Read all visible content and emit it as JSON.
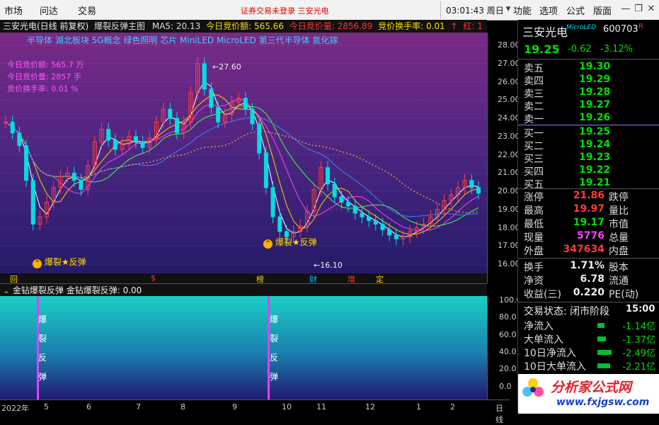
{
  "topbar": {
    "menu_left": [
      "市场",
      "问达",
      "交易"
    ],
    "notice": "证券交易未登录  三安光电",
    "clock": "03:01:43 周日",
    "menu_right": [
      "功能",
      "选项",
      "公式",
      "版面"
    ]
  },
  "main_chart": {
    "title_stock": "三安光电(日线 前复权)",
    "title_indicator": "爆裂反弹主图",
    "ma5": "MA5: 20.13",
    "auction_amount": "今日竞价额: 565.66",
    "auction_volume": "今日竞价量: 2856.89",
    "auction_turnover": "竞价换手率: 0.01",
    "red_count": "红: 1",
    "concepts": "半导体 湖北板块 5G概念 绿色照明 芯片 MiniLED MicroLED 第三代半导体 氮化镓",
    "overlay_lines": [
      "今日竞价额: 565.7 万",
      "今日竞价量: 2857 手",
      "竞价换手率: 0.01 %"
    ],
    "high_label": "27.60",
    "low_label": "16.10",
    "signal_label_1": "爆裂★反弹",
    "signal_label_2": "爆裂★反弹",
    "event_markers": [
      "回",
      "$",
      "榜",
      "财",
      "增",
      "定"
    ],
    "chart_data": {
      "type": "line",
      "title": "",
      "ylim": [
        15.5,
        28.7
      ],
      "y_ticks": [
        16.0,
        17.0,
        18.0,
        19.0,
        20.0,
        21.0,
        22.0,
        23.0,
        24.0,
        25.0,
        26.0,
        27.0,
        28.0
      ],
      "x_ticks": [
        "2022年",
        "5",
        "6",
        "7",
        "8",
        "9",
        "10",
        "11",
        "12",
        "1",
        "2",
        "日线"
      ],
      "series": [
        {
          "values": [
            23.8,
            23.2,
            22.5,
            20.6,
            18.2,
            18.6,
            19.4,
            20.2,
            20.8,
            21.0,
            20.6,
            20.1,
            21.4,
            22.7,
            23.4,
            22.8,
            22.3,
            22.6,
            23.0,
            22.7,
            22.4,
            22.9,
            23.8,
            24.5,
            24.0,
            23.2,
            23.8,
            25.4,
            27.0,
            25.6,
            24.6,
            23.8,
            24.2,
            24.9,
            25.1,
            24.5,
            23.7,
            22.1,
            20.2,
            18.6,
            17.8,
            17.5,
            17.8,
            18.1,
            18.9,
            20.1,
            21.3,
            20.4,
            19.7,
            19.4,
            19.2,
            18.8,
            18.6,
            18.4,
            18.2,
            17.9,
            17.6,
            17.4,
            17.5,
            17.8,
            18.0,
            18.2,
            18.6,
            19.0,
            19.5,
            19.8,
            20.2,
            20.6,
            20.2,
            19.9
          ]
        }
      ]
    }
  },
  "sub_chart": {
    "title": "金钻爆裂反弹 金钻爆裂反弹: 0.00",
    "vertical_text_chars": [
      "爆",
      "裂",
      "反",
      "弹"
    ],
    "y_ticks": [
      "100.0",
      "80.0",
      "60.0",
      "40.0",
      "20.0",
      "0.0"
    ]
  },
  "panel": {
    "stock_name": "三安光电",
    "concept_tag": "MicroLED",
    "code": "600703",
    "flag": "R",
    "price": "19.25",
    "change": "-0.62",
    "change_pct": "-3.12%",
    "asks": [
      {
        "label": "卖五",
        "price": "19.30"
      },
      {
        "label": "卖四",
        "price": "19.29"
      },
      {
        "label": "卖三",
        "price": "19.28"
      },
      {
        "label": "卖二",
        "price": "19.27"
      },
      {
        "label": "卖一",
        "price": "19.26"
      }
    ],
    "bids": [
      {
        "label": "买一",
        "price": "19.25"
      },
      {
        "label": "买二",
        "price": "19.24"
      },
      {
        "label": "买三",
        "price": "19.23"
      },
      {
        "label": "买四",
        "price": "19.22"
      },
      {
        "label": "买五",
        "price": "19.21"
      }
    ],
    "stats": [
      {
        "label": "涨停",
        "value": "21.86",
        "label2": "跌停"
      },
      {
        "label": "最高",
        "value": "19.97",
        "label2": "量比"
      },
      {
        "label": "最低",
        "value": "19.17",
        "label2": "市值"
      },
      {
        "label": "现量",
        "value": "5776",
        "label2": "总量"
      },
      {
        "label": "外盘",
        "value": "347634",
        "label2": "内盘"
      }
    ],
    "stats2": [
      {
        "label": "换手",
        "value": "1.71%",
        "label2": "股本"
      },
      {
        "label": "净资",
        "value": "6.78",
        "label2": "流通"
      },
      {
        "label": "收益(三)",
        "value": "0.220",
        "label2": "PE(动)"
      }
    ],
    "status_label": "交易状态: 闭市阶段",
    "status_time": "15:00",
    "flows": [
      {
        "label": "净流入",
        "value": "-1.14亿"
      },
      {
        "label": "大单流入",
        "value": "-1.37亿"
      },
      {
        "label": "10日净流入",
        "value": "-2.49亿"
      },
      {
        "label": "10日大单流入",
        "value": "-2.21亿"
      }
    ],
    "watermark_text": "分析家公式网",
    "watermark_url": "www.fxjgsw.com"
  }
}
